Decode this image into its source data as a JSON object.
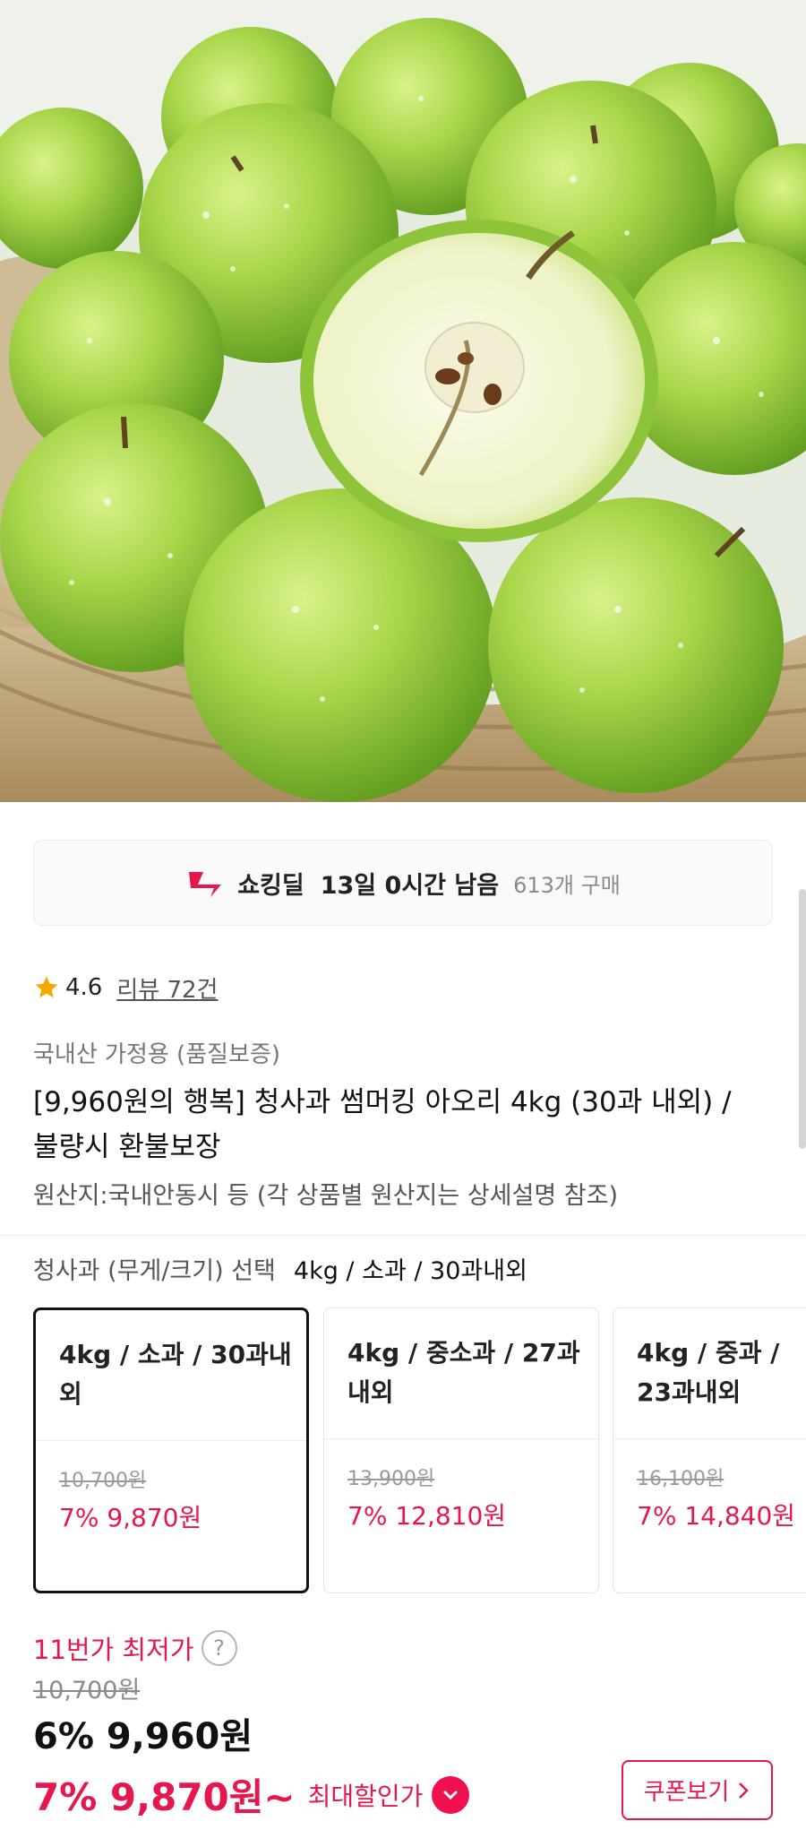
{
  "deal": {
    "title": "쇼킹딜",
    "remaining": "13일 0시간 남음",
    "purchases": "613개 구매"
  },
  "rating": {
    "score": "4.6",
    "reviews": "리뷰 72건"
  },
  "product": {
    "subcategory": "국내산 가정용 (품질보증)",
    "title": "[9,960원의 행복] 청사과 썸머킹 아오리 4kg (30과 내외) / 불량시 환불보장",
    "origin": "원산지:국내안동시 등 (각 상품별 원산지는 상세설명 참조)"
  },
  "option": {
    "label": "청사과 (무게/크기) 선택",
    "selected": "4kg / 소과 / 30과내외",
    "cards": [
      {
        "name": "4kg / 소과 / 30과내외",
        "original": "10,700원",
        "discounted": "7% 9,870원"
      },
      {
        "name": "4kg / 중소과 / 27과내외",
        "original": "13,900원",
        "discounted": "7% 12,810원"
      },
      {
        "name": "4kg / 중과 / 23과내외",
        "original": "16,100원",
        "discounted": "7% 14,840원"
      }
    ]
  },
  "pricing": {
    "lowest_label": "11번가 최저가",
    "help": "?",
    "original": "10,700원",
    "sale": "6% 9,960원",
    "max_price": "7% 9,870원~",
    "max_label": "최대할인가",
    "coupon": "쿠폰보기"
  },
  "colors": {
    "accent": "#e5174c",
    "star": "#f5a900"
  }
}
